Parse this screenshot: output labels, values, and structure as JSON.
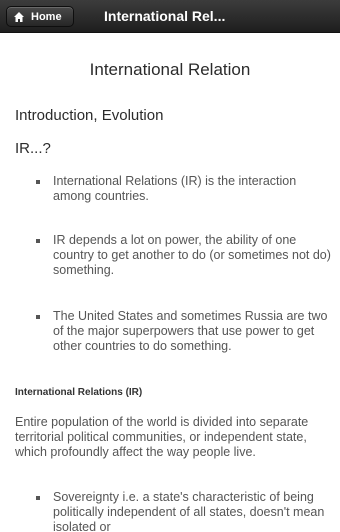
{
  "header": {
    "home_label": "Home",
    "title": "International Rel..."
  },
  "content": {
    "page_title": "International Relation",
    "heading_intro": "Introduction, Evolution",
    "heading_ir": "IR...?",
    "bullets": [
      "International Relations (IR) is the interaction among countries.",
      "IR depends a lot on power, the ability of one country to get another to do (or sometimes not do) something.",
      "The United States and sometimes Russia are two of the major superpowers that use power to get other countries to do something."
    ],
    "section_heading": "International Relations (IR)",
    "paragraph": "Entire population of the world is divided into separate territorial political communities, or independent state, which profoundly affect the way people live.",
    "bullets2": [
      "Sovereignty i.e. a state's characteristic of being politically independent of all states, doesn't mean isolated or"
    ]
  },
  "colors": {
    "header_bg": "#2a2a2a",
    "text": "#555555",
    "heading": "#2b2b2b"
  }
}
